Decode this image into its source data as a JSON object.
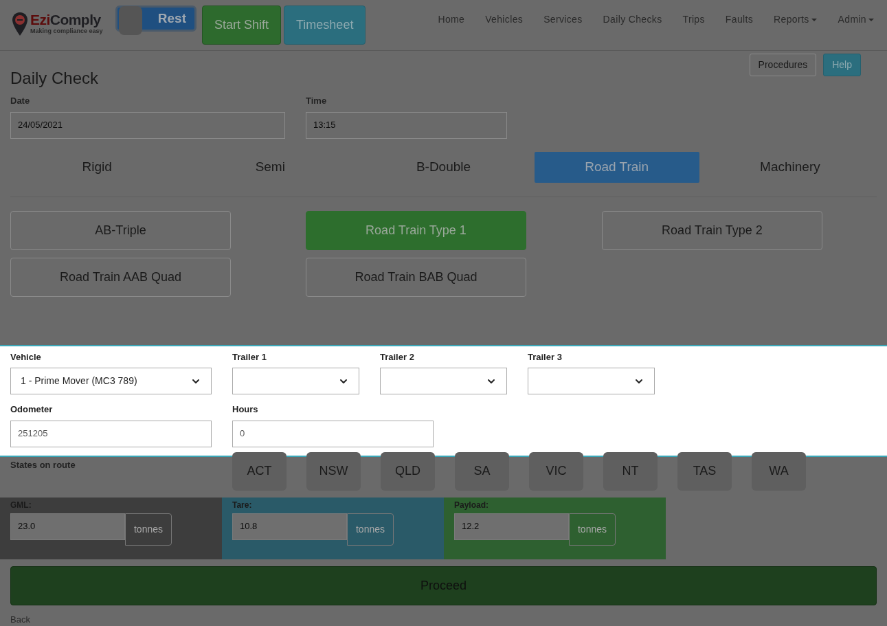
{
  "header": {
    "brand": {
      "first": "Ezi",
      "second": "Comply",
      "tagline": "Making compliance easy"
    },
    "rest_toggle": {
      "label": "Rest",
      "on": false
    },
    "buttons": [
      {
        "label": "Start Shift",
        "kind": "success"
      },
      {
        "label": "Timesheet",
        "kind": "info"
      }
    ],
    "nav": [
      {
        "label": "Home",
        "has_menu": false
      },
      {
        "label": "Vehicles",
        "has_menu": false
      },
      {
        "label": "Services",
        "has_menu": false
      },
      {
        "label": "Daily Checks",
        "has_menu": false
      },
      {
        "label": "Trips",
        "has_menu": false
      },
      {
        "label": "Faults",
        "has_menu": false
      },
      {
        "label": "Reports",
        "has_menu": true
      },
      {
        "label": "Admin",
        "has_menu": true
      }
    ]
  },
  "page": {
    "title": "Daily Check",
    "actions": [
      {
        "label": "Procedures",
        "kind": "default"
      },
      {
        "label": "Help",
        "kind": "info"
      }
    ],
    "date": {
      "label": "Date",
      "value": "24/05/2021"
    },
    "time": {
      "label": "Time",
      "value": "13:15"
    },
    "categories": [
      {
        "label": "Rigid",
        "selected": false
      },
      {
        "label": "Semi",
        "selected": false
      },
      {
        "label": "B-Double",
        "selected": false
      },
      {
        "label": "Road Train",
        "selected": true
      },
      {
        "label": "Machinery",
        "selected": false
      }
    ],
    "types": [
      {
        "label": "AB-Triple",
        "selected": false
      },
      {
        "label": "Road Train Type 1",
        "selected": true
      },
      {
        "label": "Road Train Type 2",
        "selected": false
      },
      {
        "label": "Road Train AAB Quad",
        "selected": false
      },
      {
        "label": "Road Train BAB Quad",
        "selected": false
      }
    ],
    "selects": [
      {
        "label": "Vehicle",
        "value": "1 - Prime Mover (MC3 789)"
      },
      {
        "label": "Trailer 1"
      },
      {
        "label": "Trailer 2"
      },
      {
        "label": "Trailer 3"
      }
    ],
    "odometer": {
      "label": "Odometer",
      "value": "251205"
    },
    "hours": {
      "label": "Hours",
      "value": "0"
    },
    "states_label": "States on route",
    "states": [
      "ACT",
      "NSW",
      "QLD",
      "SA",
      "VIC",
      "NT",
      "TAS",
      "WA"
    ],
    "weights": [
      {
        "label": "GML:",
        "value": "23.0",
        "unit": "tonnes",
        "color": "#3d3d3d"
      },
      {
        "label": "Tare:",
        "value": "10.8",
        "unit": "tonnes",
        "color": "#2a5a68"
      },
      {
        "label": "Payload:",
        "value": "12.2",
        "unit": "tonnes",
        "color": "#2e6030"
      }
    ],
    "proceed": "Proceed",
    "back": "Back"
  }
}
